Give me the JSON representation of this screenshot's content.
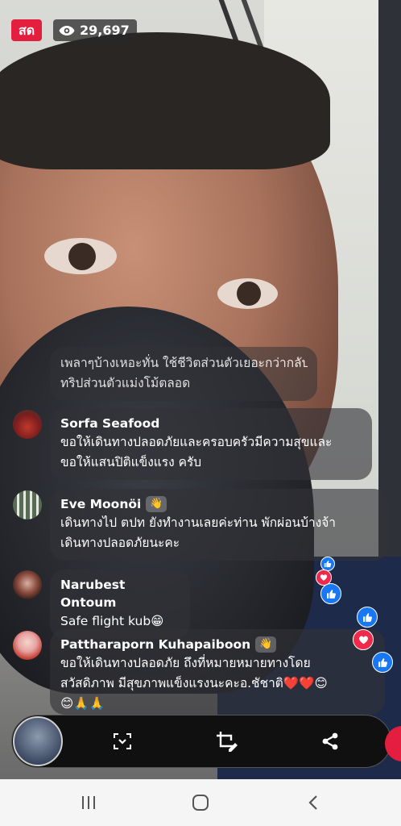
{
  "header": {
    "live_label": "สด",
    "viewer_count": "29,697"
  },
  "comments": [
    {
      "name": "",
      "text_line1": "เพลาๆบ้างเหอะทั่น ใช้ชีวิตส่วนตัวเยอะกว่ากลับบ้าน",
      "text_line2": "ทริปส่วนตัวแม่งโม้ตลอด",
      "avatar": "avatar-hidden"
    },
    {
      "name": "Sorfa Seafood",
      "text_line1": "ขอให้เดินทางปลอดภัยและครอบครัวมีความสุขและ",
      "text_line2": "ขอให้แสนปิติแข็งแรง ครับ",
      "avatar": "avatar-car"
    },
    {
      "name": "Eve Moonöi",
      "badge": "wave-icon",
      "text_line1": "เดินทางไป ตปท ยังทำงานเลยค่ะท่าน พักผ่อนบ้างจ้า",
      "text_line2": "เดินทางปลอดภัยนะคะ",
      "avatar": "avatar-building"
    },
    {
      "name": "Narubest Ontoum",
      "text_line1": "Safe flight kub😁",
      "avatar": "avatar-portrait"
    },
    {
      "name": "Pattharaporn Kuhapaiboon",
      "badge": "wave-icon",
      "text_line1": "ขอให้เดินทางปลอดภัย ถึงที่หมายหมายทางโดย",
      "text_line2": "สวัสดิภาพ มีสุขภาพแข็งแรงนะคะอ.ชัชาติ❤️❤️😊",
      "text_line3": "😊🙏🙏",
      "avatar": "avatar-woman"
    }
  ],
  "colors": {
    "live_red": "#e41e3f",
    "like_blue": "#1877f2",
    "heart_red": "#f0284a"
  },
  "controls": {
    "icons": [
      "thumbnail",
      "collapse-icon",
      "crop-edit-icon",
      "share-icon",
      "end-live-icon"
    ]
  },
  "navbar": {
    "icons": [
      "recent-apps-icon",
      "home-icon",
      "back-icon"
    ]
  }
}
